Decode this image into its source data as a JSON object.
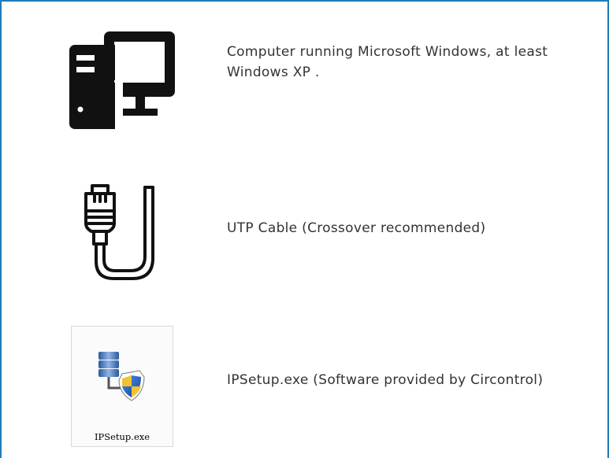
{
  "requirements": [
    {
      "icon": "desktop-computer-icon",
      "text": "Computer running Microsoft Windows, at least Windows XP ."
    },
    {
      "icon": "utp-cable-icon",
      "text": "UTP Cable (Crossover recommended)"
    },
    {
      "icon": "setup-program-icon",
      "text": "IPSetup.exe (Software provided by Circontrol)",
      "file_label": "IPSetup.exe"
    }
  ],
  "colors": {
    "frame_border": "#1f7bb6",
    "text": "#333333",
    "icon": "#111111"
  }
}
